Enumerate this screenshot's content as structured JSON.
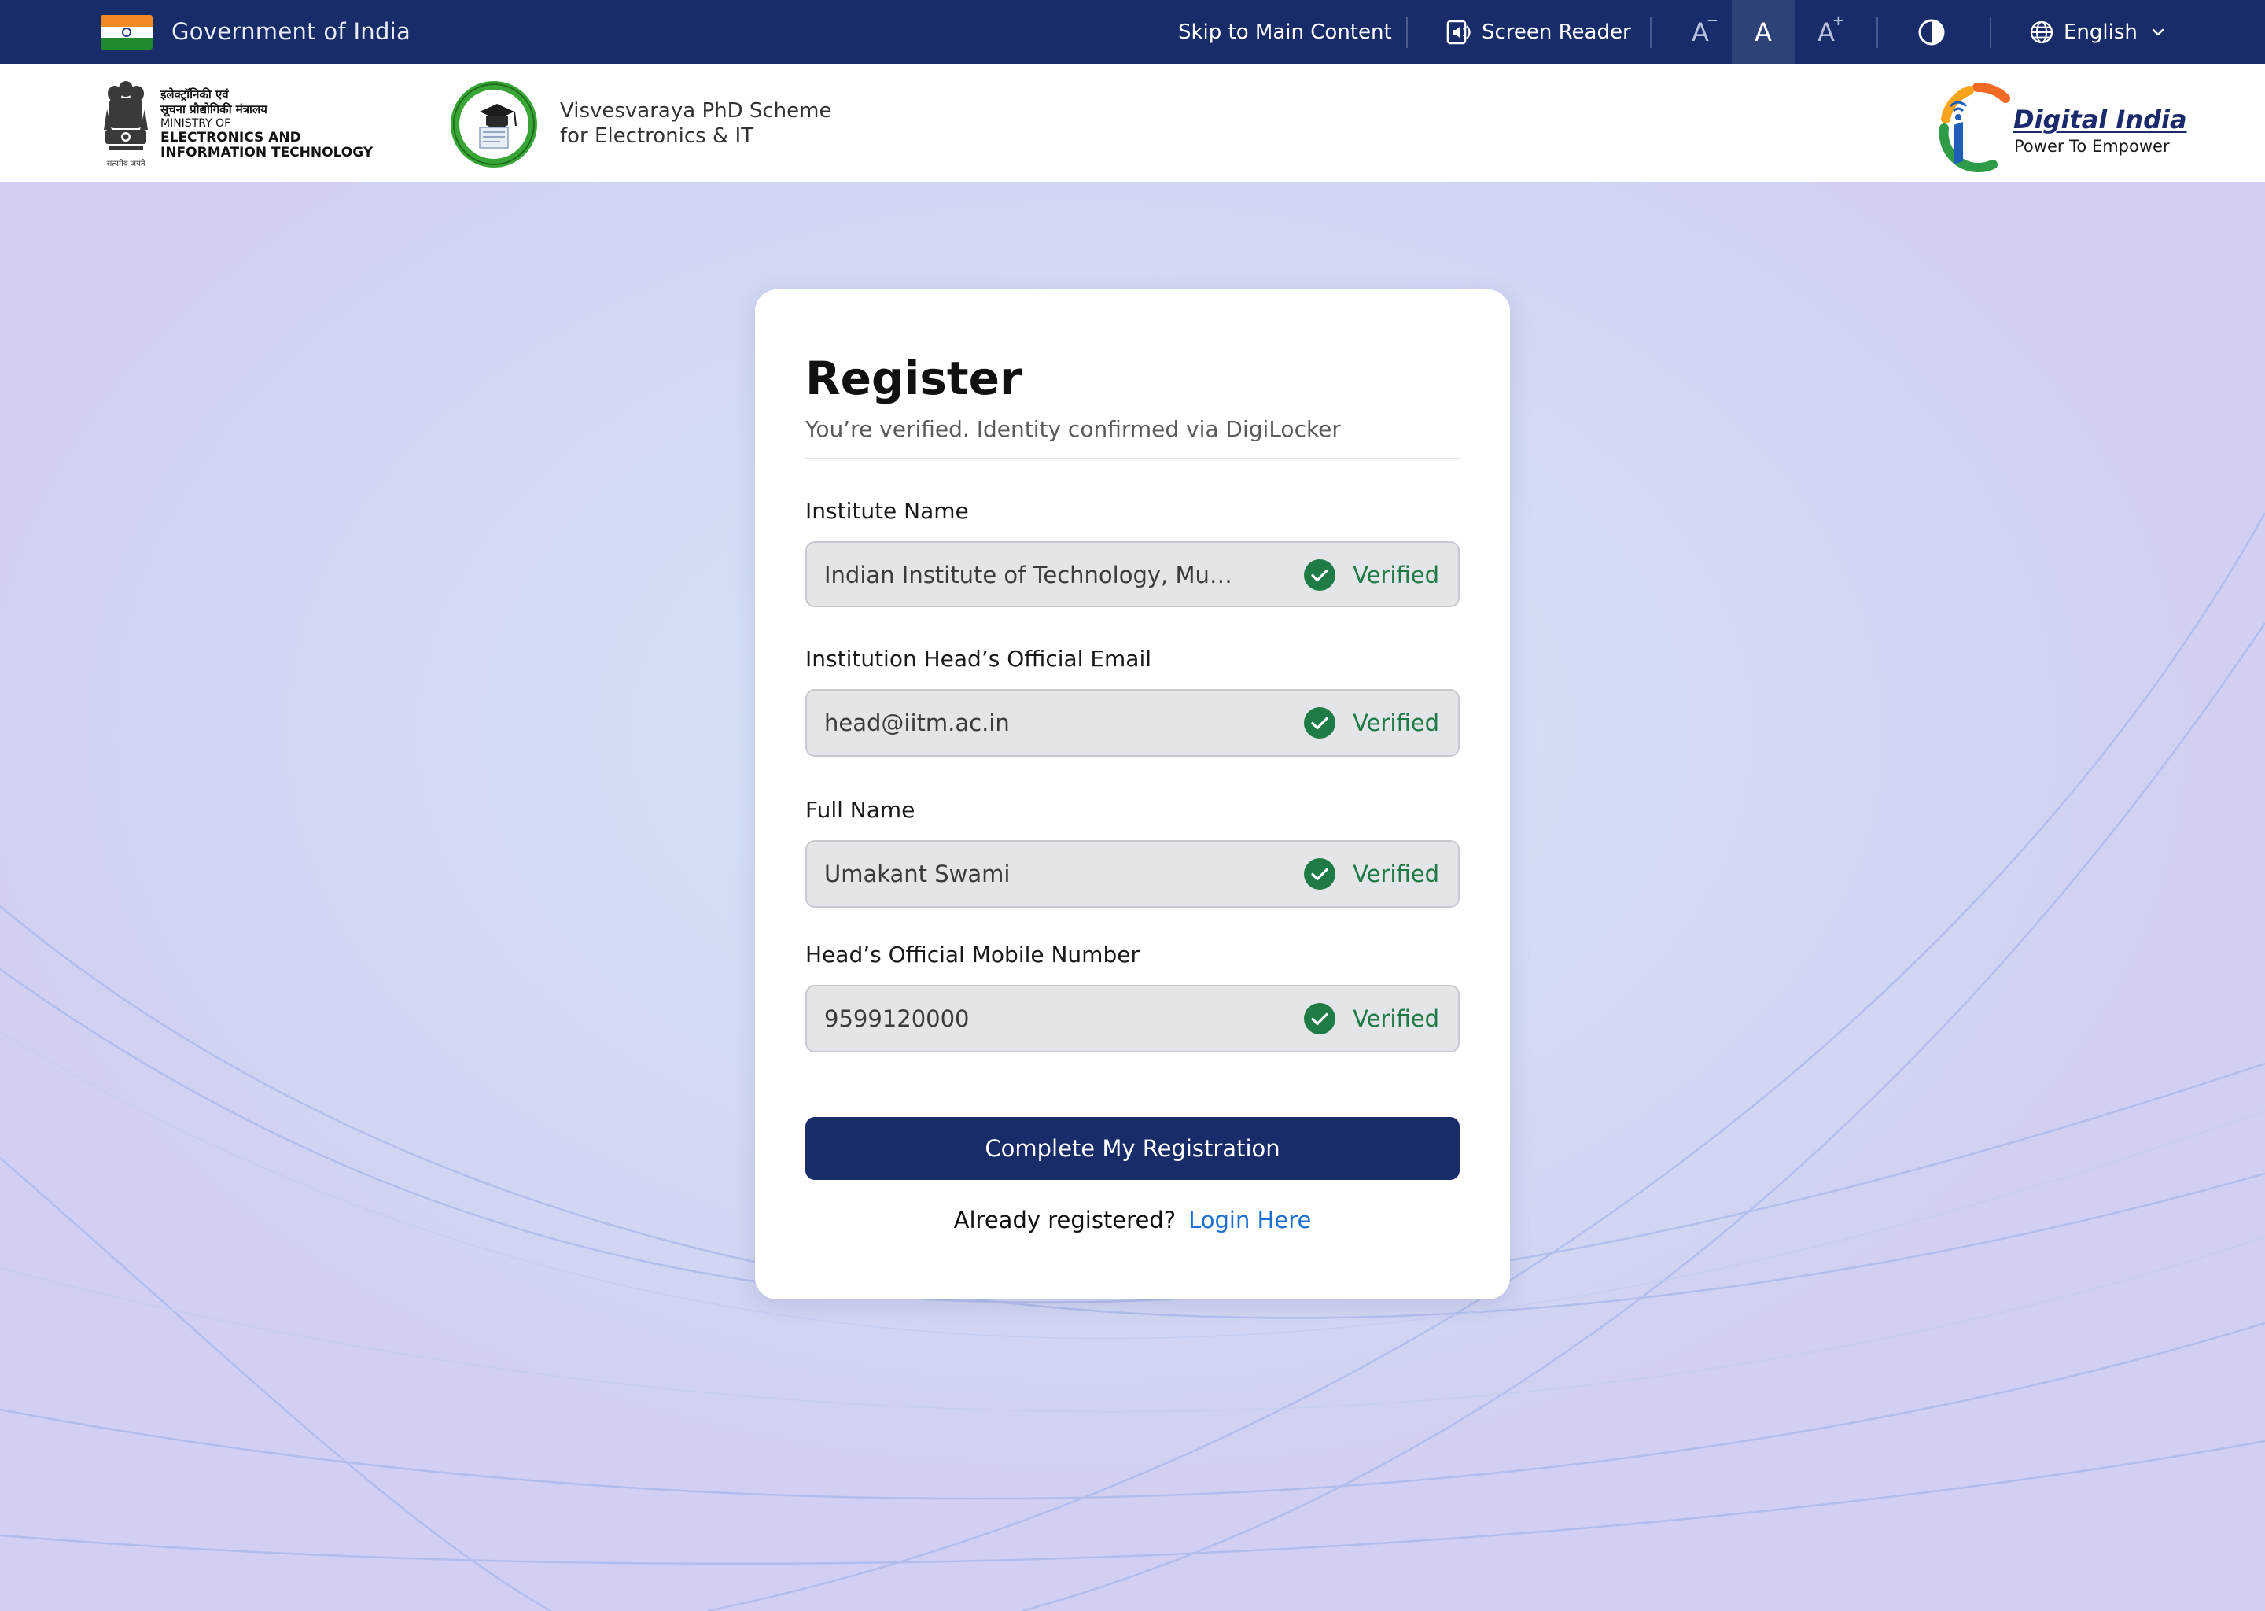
{
  "topbar": {
    "gov_label": "Government of India",
    "skip_label": "Skip to Main Content",
    "screen_reader_label": "Screen Reader",
    "font_decrease_label": "A",
    "font_default_label": "A",
    "font_increase_label": "A",
    "language_selected": "English",
    "icons": [
      "india-flag-icon",
      "screen-reader-icon",
      "contrast-icon",
      "globe-icon",
      "chevron-down-icon"
    ],
    "colors": {
      "bar": "#172c68",
      "active": "#2d4378"
    }
  },
  "header": {
    "ministry": {
      "line_hi_1": "इलेक्ट्रॉनिकी एवं",
      "line_hi_2": "सूचना प्रौद्योगिकी मंत्रालय",
      "line_en_1": "MINISTRY OF",
      "line_en_2": "ELECTRONICS AND",
      "line_en_3": "INFORMATION TECHNOLOGY",
      "motto": "सत्यमेव जयते"
    },
    "scheme": {
      "line1": "Visvesvaraya PhD Scheme",
      "line2": "for Electronics & IT"
    },
    "digital_india": {
      "title": "Digital India",
      "subtitle": "Power To Empower"
    }
  },
  "form": {
    "title": "Register",
    "subtitle": "You’re verified. Identity confirmed via DigiLocker",
    "fields": [
      {
        "label": "Institute Name",
        "value": "Indian Institute of Technology, Mumbai",
        "status": "Verified"
      },
      {
        "label": "Institution Head’s Official Email",
        "value": "head@iitm.ac.in",
        "status": "Verified"
      },
      {
        "label": "Full Name",
        "value": "Umakant Swami",
        "status": "Verified"
      },
      {
        "label": "Head’s Official Mobile Number",
        "value": "9599120000",
        "status": "Verified"
      }
    ],
    "submit_label": "Complete My Registration",
    "login_prompt": "Already registered?",
    "login_link": "Login Here",
    "colors": {
      "verified": "#1e7b45",
      "primary": "#172c68",
      "link": "#1a6fd0"
    }
  }
}
